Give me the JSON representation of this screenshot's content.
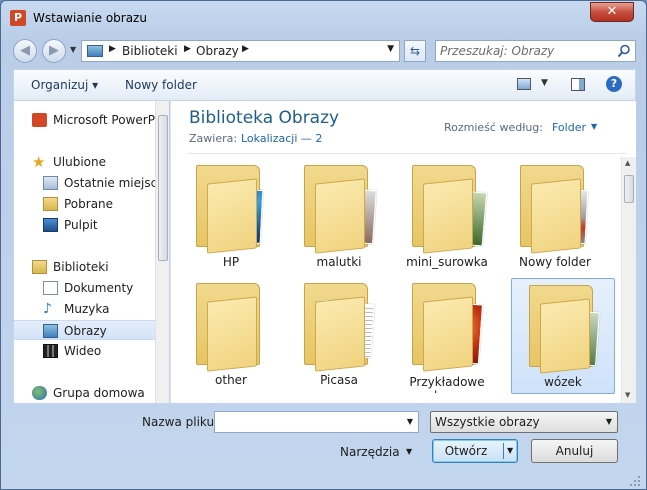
{
  "window": {
    "title": "Wstawianie obrazu",
    "app_icon": "P",
    "close_glyph": "✕"
  },
  "nav": {
    "back_glyph": "◀",
    "forward_glyph": "▶",
    "breadcrumb": [
      "Biblioteki",
      "Obrazy"
    ],
    "refresh_glyph": "⇆",
    "search_placeholder": "Przeszukaj: Obrazy"
  },
  "toolbar": {
    "organize_label": "Organizuj ▾",
    "new_folder_label": "Nowy folder",
    "help_glyph": "?"
  },
  "sidebar": {
    "items": [
      {
        "label": "Microsoft PowerPoint",
        "icon": "powerpoint-icon"
      },
      {
        "label": "Ulubione",
        "icon": "star-icon"
      },
      {
        "label": "Ostatnie miejsca",
        "icon": "recent-places-icon"
      },
      {
        "label": "Pobrane",
        "icon": "downloads-icon"
      },
      {
        "label": "Pulpit",
        "icon": "desktop-icon"
      },
      {
        "label": "Biblioteki",
        "icon": "libraries-icon"
      },
      {
        "label": "Dokumenty",
        "icon": "documents-icon"
      },
      {
        "label": "Muzyka",
        "icon": "music-icon"
      },
      {
        "label": "Obrazy",
        "icon": "pictures-icon",
        "selected": true
      },
      {
        "label": "Wideo",
        "icon": "video-icon"
      },
      {
        "label": "Grupa domowa",
        "icon": "homegroup-icon"
      }
    ]
  },
  "library": {
    "title": "Biblioteka Obrazy",
    "includes_label": "Zawiera:",
    "includes_link": "Lokalizacji — 2",
    "arrange_label": "Rozmieść według:",
    "arrange_value": "Folder"
  },
  "folders": [
    {
      "name": "HP"
    },
    {
      "name": "malutki"
    },
    {
      "name": "mini_surowka"
    },
    {
      "name": "Nowy folder"
    },
    {
      "name": "other"
    },
    {
      "name": "Picasa"
    },
    {
      "name": "Przykładowe obrazy"
    },
    {
      "name": "wózek",
      "selected": true
    }
  ],
  "footer": {
    "filename_label": "Nazwa pliku:",
    "filename_value": "",
    "filetype_value": "Wszystkie obrazy",
    "tools_label": "Narzędzia",
    "open_label": "Otwórz",
    "cancel_label": "Anuluj"
  }
}
